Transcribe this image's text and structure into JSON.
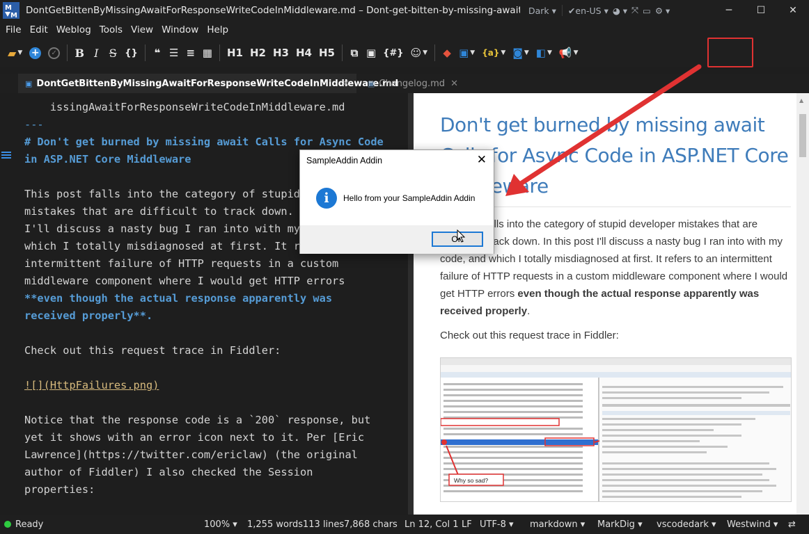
{
  "window": {
    "title": "DontGetBittenByMissingAwaitForResponseWriteCodeInMiddleware.md  –  Dont-get-bitten-by-missing-await-for-Re...",
    "theme_label": "Dark",
    "language_label": "en-US"
  },
  "menu": [
    "File",
    "Edit",
    "Weblog",
    "Tools",
    "View",
    "Window",
    "Help"
  ],
  "toolbar": {
    "bold": "B",
    "italic": "I",
    "strike": "S",
    "code": "{}",
    "h1": "H1",
    "h2": "H2",
    "h3": "H3",
    "h4": "H4",
    "h5": "H5",
    "snippet": "{#}"
  },
  "tabs": [
    {
      "label": "DontGetBittenByMissingAwaitForResponseWriteCodeInMiddleware.md",
      "active": true
    },
    {
      "label": "Changelog.md",
      "active": false
    }
  ],
  "editor": {
    "lines": [
      "    issingAwaitForResponseWriteCodeInMiddleware.md",
      "---",
      "# Don't get burned by missing await Calls for Async Code",
      "in ASP.NET Core Middleware",
      "",
      "This post falls into the category of stupid developer",
      "mistakes that are difficult to track down. In this post",
      "I'll discuss a nasty bug I ran into with my code, and",
      "which I totally misdiagnosed at first. It refers to an",
      "intermittent failure of HTTP requests in a custom",
      "middleware component where I would get HTTP errors",
      "**even though the actual response apparently was",
      "received properly**.",
      "",
      "Check out this request trace in Fiddler:",
      "",
      "![](HttpFailures.png)",
      "",
      "Notice that the response code is a `200` response, but",
      "yet it shows with an error icon next to it. Per [Eric",
      "Lawrence](https://twitter.com/ericlaw) (the original",
      "author of Fiddler) I also checked the Session",
      "properties:"
    ]
  },
  "preview": {
    "title": "Don't get burned by missing await Calls for Async Code in ASP.NET Core Middleware",
    "para1": "This post falls into the category of stupid developer mistakes that are difficult to track down. In this post I'll discuss a nasty bug I ran into with my code, and which I totally misdiagnosed at first. It refers to an intermittent failure of HTTP requests in a custom middleware component where I would get HTTP errors ",
    "para1_bold": "even though the actual response apparently was received properly",
    "para1_end": ".",
    "para2": "Check out this request trace in Fiddler:",
    "image_callout": "Why so sad?"
  },
  "dialog": {
    "title": "SampleAddin Addin",
    "message": "Hello from your SampleAddin Addin",
    "ok_label": "OK"
  },
  "status": {
    "ready": "Ready",
    "zoom": "100%",
    "words": "1,255 words",
    "lines": "113 lines",
    "chars": "7,868 chars",
    "position": "Ln 12, Col 1",
    "line_ending": "LF",
    "encoding": "UTF-8",
    "syntax": "markdown",
    "parser": "MarkDig",
    "theme": "vscodedark",
    "preview_theme": "Westwind"
  },
  "colors": {
    "accent": "#3f7cba",
    "highlight": "#e03232"
  }
}
